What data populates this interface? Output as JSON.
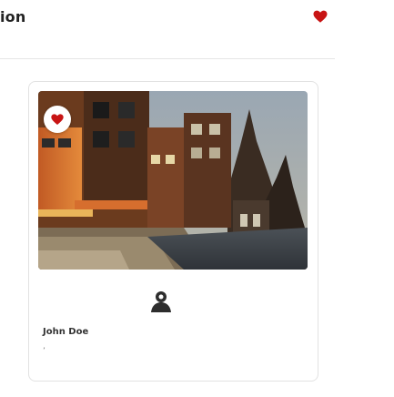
{
  "header": {
    "title": "ion",
    "favorite_icon": "heart-icon"
  },
  "card": {
    "image_alt": "",
    "favorite_icon": "heart-icon",
    "avatar_icon": "user-avatar-icon",
    "author": "John Doe",
    "meta": "’"
  },
  "colors": {
    "heart": "#c81414",
    "border": "#e2e2e2",
    "text": "#333333"
  }
}
